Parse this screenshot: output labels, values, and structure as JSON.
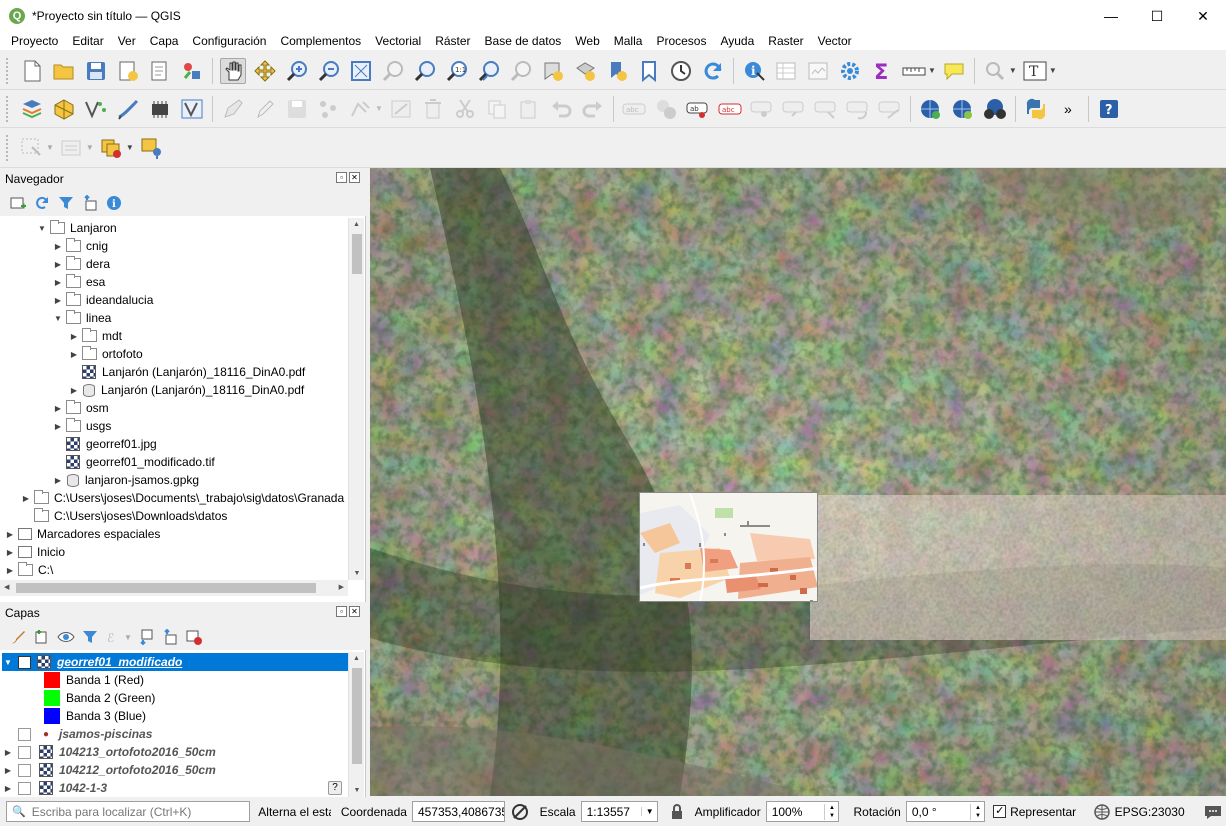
{
  "window": {
    "title": "*Proyecto sin título — QGIS",
    "logo_letter": "Q",
    "minimize": "—",
    "maximize": "☐",
    "close": "✕"
  },
  "menu": [
    "Proyecto",
    "Editar",
    "Ver",
    "Capa",
    "Configuración",
    "Complementos",
    "Vectorial",
    "Ráster",
    "Base de datos",
    "Web",
    "Malla",
    "Procesos",
    "Ayuda",
    "Raster",
    "Vector"
  ],
  "browser": {
    "title": "Navegador",
    "items": [
      {
        "label": "Lanjaron",
        "arrow": "▼"
      },
      {
        "label": "cnig",
        "arrow": "▶"
      },
      {
        "label": "dera",
        "arrow": "▶"
      },
      {
        "label": "esa",
        "arrow": "▶"
      },
      {
        "label": "ideandalucia",
        "arrow": "▶"
      },
      {
        "label": "linea",
        "arrow": "▼"
      },
      {
        "label": "mdt",
        "arrow": "▶"
      },
      {
        "label": "ortofoto",
        "arrow": "▶"
      },
      {
        "label": "Lanjarón (Lanjarón)_18116_DinA0.pdf",
        "arrow": ""
      },
      {
        "label": "Lanjarón (Lanjarón)_18116_DinA0.pdf",
        "arrow": "▶"
      },
      {
        "label": "osm",
        "arrow": "▶"
      },
      {
        "label": "usgs",
        "arrow": "▶"
      },
      {
        "label": "georref01.jpg",
        "arrow": ""
      },
      {
        "label": "georref01_modificado.tif",
        "arrow": ""
      },
      {
        "label": "lanjaron-jsamos.gpkg",
        "arrow": "▶"
      },
      {
        "label": "C:\\Users\\joses\\Documents\\_trabajo\\sig\\datos\\Granada",
        "arrow": "▶"
      },
      {
        "label": "C:\\Users\\joses\\Downloads\\datos",
        "arrow": ""
      },
      {
        "label": "Marcadores espaciales",
        "arrow": "▶"
      },
      {
        "label": "Inicio",
        "arrow": "▶"
      },
      {
        "label": "C:\\",
        "arrow": "▶"
      }
    ]
  },
  "layers": {
    "title": "Capas",
    "selected": {
      "label": "georref01_modificado",
      "check": "✓",
      "arrow": "▼"
    },
    "bands": [
      {
        "label": "Banda 1 (Red)",
        "color": "#ff0000"
      },
      {
        "label": "Banda 2 (Green)",
        "color": "#00ff00"
      },
      {
        "label": "Banda 3 (Blue)",
        "color": "#0000ff"
      }
    ],
    "items": [
      {
        "label": "jsamos-piscinas",
        "arrow": ""
      },
      {
        "label": "104213_ortofoto2016_50cm",
        "arrow": "▶"
      },
      {
        "label": "104212_ortofoto2016_50cm",
        "arrow": "▶"
      },
      {
        "label": "1042-1-3",
        "arrow": "▶"
      }
    ]
  },
  "statusbar": {
    "search_placeholder": "Escriba para localizar (Ctrl+K)",
    "toggle_label": "Alterna el estac",
    "coord_label": "Coordenada",
    "coord_value": "457353,4086735",
    "scale_label": "Escala",
    "scale_value": "1:13557",
    "magnifier_label": "Amplificador",
    "magnifier_value": "100%",
    "rotation_label": "Rotación",
    "rotation_value": "0,0 °",
    "render_label": "Representar",
    "crs": "EPSG:23030"
  },
  "icons": {
    "search": "🔍",
    "help": "?"
  }
}
